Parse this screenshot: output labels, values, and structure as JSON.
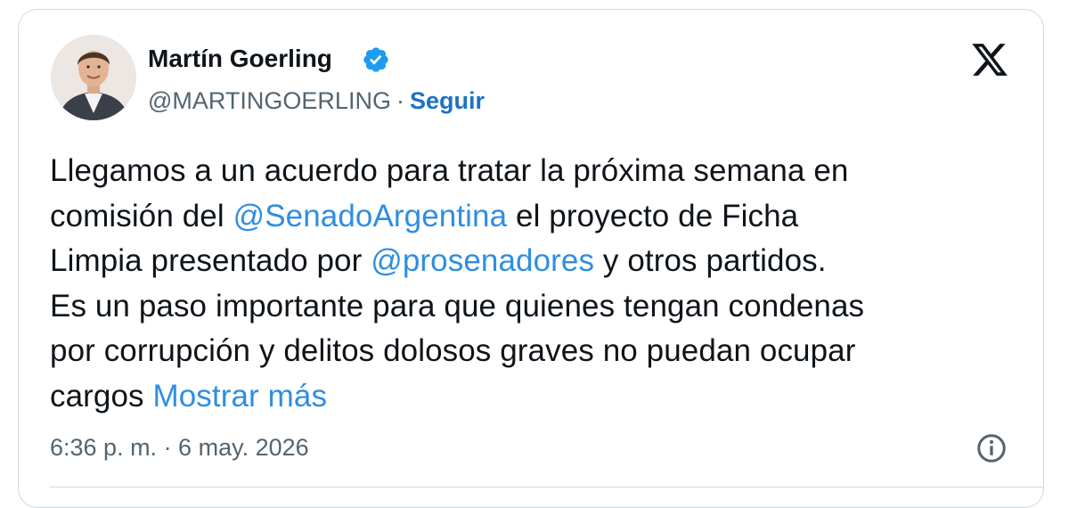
{
  "author": {
    "display_name": "Martín Goerling",
    "handle": "@MARTINGOERLING",
    "separator": "·",
    "follow_label": "Seguir",
    "verified": true,
    "verified_color": "#1d9bf0"
  },
  "platform": {
    "logo_icon": "x-logo-icon"
  },
  "tweet": {
    "line1": "Llegamos a un acuerdo para tratar la próxima semana en",
    "line2_pre": "comisión del ",
    "mention1": "@SenadoArgentina",
    "line2_post": " el proyecto de Ficha",
    "line3_pre": "Limpia presentado por ",
    "mention2": "@prosenadores",
    "line3_post": " y otros partidos.",
    "line4": "Es un paso importante para que quienes tengan condenas",
    "line5": "por corrupción y delitos dolosos graves no puedan ocupar",
    "line6_pre": "cargos ",
    "show_more": "Mostrar más"
  },
  "meta": {
    "timestamp": "6:36 p. m. · 6 may. 2026",
    "info_icon": "info-icon"
  },
  "colors": {
    "link": "#2f8ee0",
    "follow": "#1d72c5",
    "text": "#0f1419",
    "muted": "#536471",
    "border": "#cfd9de"
  }
}
